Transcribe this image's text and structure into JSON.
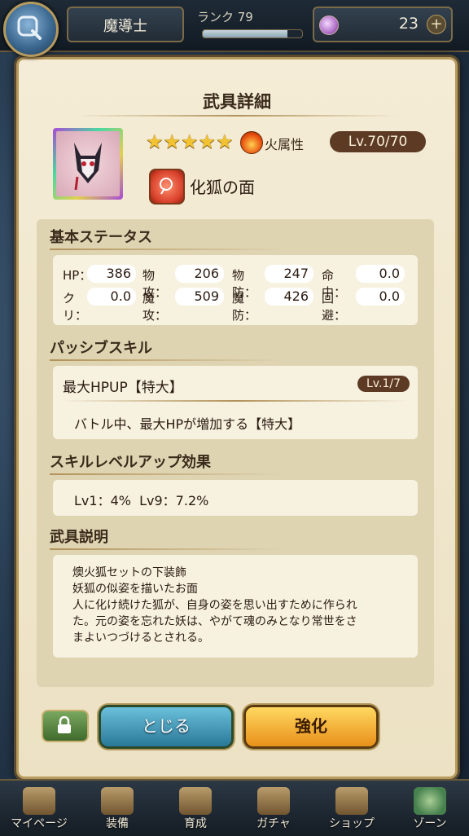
{
  "header": {
    "job": "魔導士",
    "rank_label": "ランク 79",
    "rank_progress": 0.85,
    "gem_count": "23",
    "plus_label": "+"
  },
  "panel": {
    "title": "武具詳細",
    "stars": "★★★★★",
    "attribute": "火属性",
    "level": "Lv.70/70",
    "item_name": "化狐の面"
  },
  "basic_status": {
    "title": "基本ステータス",
    "stats": [
      {
        "label": "HP：",
        "value": "386"
      },
      {
        "label": "物攻：",
        "value": "206"
      },
      {
        "label": "物防：",
        "value": "247"
      },
      {
        "label": "命中：",
        "value": "0.0"
      },
      {
        "label": "クリ：",
        "value": "0.0"
      },
      {
        "label": "魔攻：",
        "value": "509"
      },
      {
        "label": "魔防：",
        "value": "426"
      },
      {
        "label": "回避：",
        "value": "0.0"
      }
    ]
  },
  "passive": {
    "title": "パッシブスキル",
    "skill_name": "最大HPUP【特大】",
    "skill_level": "Lv.1/7",
    "skill_desc": "バトル中、最大HPが増加する【特大】"
  },
  "levelup": {
    "title": "スキルレベルアップ効果",
    "text": "Lv1：4%  Lv9：7.2%"
  },
  "description": {
    "title": "武具説明",
    "lines": [
      "燠火狐セットの下装飾",
      "妖狐の似姿を描いたお面",
      "人に化け続けた狐が、自身の姿を思い出すために作られ",
      "た。元の姿を忘れた妖は、やがて魂のみとなり常世をさ",
      "まよいつづけるとされる。"
    ]
  },
  "buttons": {
    "close": "とじる",
    "enhance": "強化"
  },
  "nav": [
    {
      "label": "マイページ",
      "icon": "scroll-icon"
    },
    {
      "label": "装備",
      "icon": "equipment-icon"
    },
    {
      "label": "育成",
      "icon": "training-icon"
    },
    {
      "label": "ガチャ",
      "icon": "gacha-icon"
    },
    {
      "label": "ショップ",
      "icon": "shop-icon"
    },
    {
      "label": "ゾーン",
      "icon": "globe-icon"
    }
  ]
}
